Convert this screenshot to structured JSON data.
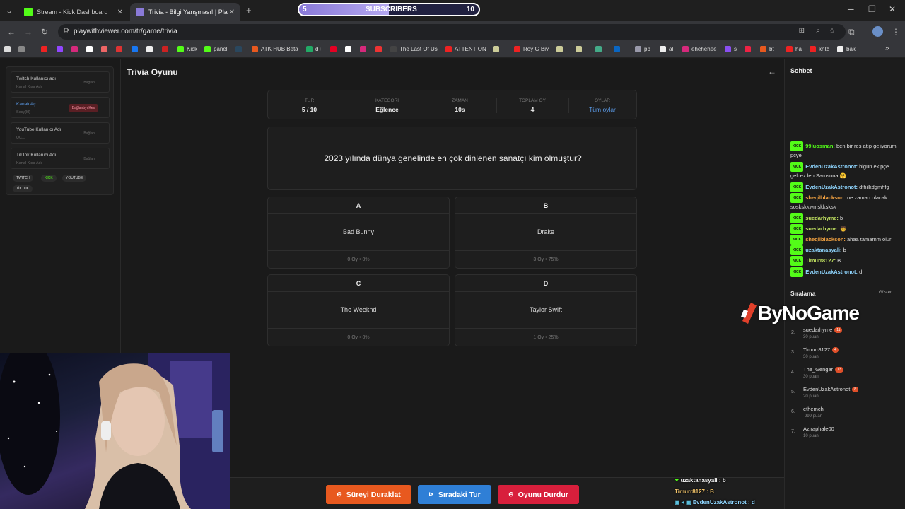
{
  "browser": {
    "tabs": [
      {
        "title": "Stream - Kick Dashboard",
        "favicon_color": "#53fc18"
      },
      {
        "title": "Trivia - Bilgi Yarışması! | Pla",
        "favicon_color": "#8a7ad8"
      }
    ],
    "new_tab_label": "+",
    "url": "playwithviewer.com/tr/game/trivia",
    "bookmarks": [
      "Kick",
      "panel",
      "ATK HUB Beta",
      "d+",
      "The Last Of Us",
      "ATTENTION",
      "Roy G Biv",
      "pb",
      "al",
      "ehehehee",
      "s",
      "bt",
      "ha",
      "knlz",
      "bak"
    ]
  },
  "subscribers_overlay": {
    "label": "SUBSCRIBERS",
    "current": "5",
    "goal": "10",
    "progress": 0.5
  },
  "left_panel": {
    "items": [
      {
        "title": "Twitch Kullanıcı adı",
        "sub": "Kanal Kısa Adı",
        "action": "Bağlan"
      },
      {
        "title": "Kanalı Aç",
        "sub": "Sesy(lfl)",
        "action": "Bağlantıyı Kes"
      },
      {
        "title": "YouTube Kullanıcı Adı",
        "sub": "UC...",
        "action": "Bağlan"
      },
      {
        "title": "TikTok Kullanıcı Adı",
        "sub": "Kanal Kısa Adı",
        "action": "Bağlan"
      }
    ],
    "platforms": [
      "TWITCH",
      "KICK",
      "YOUTUBE",
      "TİKTOK"
    ]
  },
  "game": {
    "title": "Trivia Oyunu",
    "back_icon": "arrow-left-icon",
    "stats": [
      {
        "key": "TUR",
        "value": "5 / 10"
      },
      {
        "key": "KATEGORİ",
        "value": "Eğlence"
      },
      {
        "key": "ZAMAN",
        "value": "10s"
      },
      {
        "key": "TOPLAM OY",
        "value": "4"
      },
      {
        "key": "OYLAR",
        "value": "Tüm oylar"
      }
    ],
    "question": "2023 yılında dünya genelinde en çok dinlenen sanatçı kim olmuştur?",
    "options": [
      {
        "letter": "A",
        "answer": "Bad Bunny",
        "votes": "0 Oy • 0%"
      },
      {
        "letter": "B",
        "answer": "Drake",
        "votes": "3 Oy • 75%"
      },
      {
        "letter": "C",
        "answer": "The Weeknd",
        "votes": "0 Oy • 0%"
      },
      {
        "letter": "D",
        "answer": "Taylor Swift",
        "votes": "1 Oy • 25%"
      }
    ],
    "buttons": [
      {
        "label": "Süreyi Duraklat",
        "color": "#e8591f"
      },
      {
        "label": "Sıradaki Tur",
        "color": "#2f7fd6"
      },
      {
        "label": "Oyunu Durdur",
        "color": "#d81f3c"
      }
    ]
  },
  "sidebar": {
    "chat_title": "Sohbet",
    "badge": "KICK",
    "messages": [
      {
        "user": "99luosman:",
        "text": "ben bir res atıp geliyorum pcye"
      },
      {
        "user": "EvdenUzakAstronot:",
        "text": "bigün ekipçe gelcez len Samsuna 🤗"
      },
      {
        "user": "EvdenUzakAstronot:",
        "text": "dfhilkdgmhfg"
      },
      {
        "user": "sheqilblackson:",
        "text": "ne zaman olacak soskskkwmskksksk"
      },
      {
        "user": "suedarhyme:",
        "text": "b"
      },
      {
        "user": "suedarhyme:",
        "text": "🧑"
      },
      {
        "user": "sheqilblackson:",
        "text": "ahaa tamamm olur"
      },
      {
        "user": "uzaktanasyali:",
        "text": "b"
      },
      {
        "user": "Timurr8127:",
        "text": "B"
      },
      {
        "user": "EvdenUzakAstronot:",
        "text": "d"
      }
    ],
    "ranking_title": "Sıralama",
    "ranking_toggle": "Göster",
    "ranking": [
      {
        "rank": "2.",
        "name": "suedarhyme",
        "badge": "11",
        "points": "30 puan"
      },
      {
        "rank": "3.",
        "name": "Timurr8127",
        "badge": "4",
        "points": "30 puan"
      },
      {
        "rank": "4.",
        "name": "The_Gengar",
        "badge": "13",
        "points": "30 puan"
      },
      {
        "rank": "5.",
        "name": "EvdenUzakAstronot",
        "badge": "8",
        "points": "20 puan"
      },
      {
        "rank": "6.",
        "name": "ethemchi",
        "badge": "",
        "points": "-999 puan"
      },
      {
        "rank": "7.",
        "name": "Aziraphale00",
        "badge": "",
        "points": "10 puan"
      }
    ]
  },
  "overlay_chat": [
    {
      "text": "uzaktanasyali : b"
    },
    {
      "text": "Timurr8127 : B"
    },
    {
      "text": "EvdenUzakAstronot : d"
    }
  ],
  "logo_text": "ByNoGame"
}
